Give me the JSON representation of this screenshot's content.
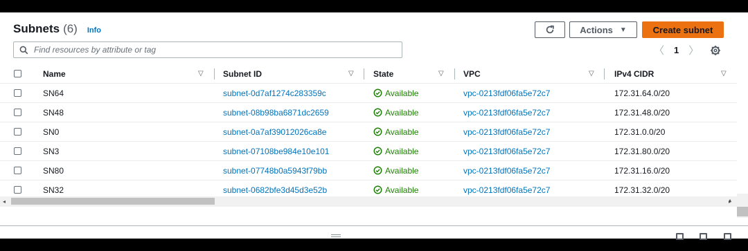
{
  "header": {
    "title": "Subnets",
    "count": "(6)",
    "info": "Info"
  },
  "toolbar": {
    "refresh_icon": "refresh-icon",
    "actions_label": "Actions",
    "create_label": "Create subnet",
    "accent_color": "#ec7211"
  },
  "search": {
    "placeholder": "Find resources by attribute or tag",
    "value": ""
  },
  "pagination": {
    "current_page": "1",
    "prev_icon": "chevron-left-icon",
    "next_icon": "chevron-right-icon",
    "settings_icon": "gear-icon"
  },
  "table": {
    "columns": [
      "Name",
      "Subnet ID",
      "State",
      "VPC",
      "IPv4 CIDR"
    ],
    "rows": [
      {
        "name": "SN64",
        "subnet_id": "subnet-0d7af1274c283359c",
        "state": "Available",
        "vpc": "vpc-0213fdf06fa5e72c7",
        "cidr": "172.31.64.0/20"
      },
      {
        "name": "SN48",
        "subnet_id": "subnet-08b98ba6871dc2659",
        "state": "Available",
        "vpc": "vpc-0213fdf06fa5e72c7",
        "cidr": "172.31.48.0/20"
      },
      {
        "name": "SN0",
        "subnet_id": "subnet-0a7af39012026ca8e",
        "state": "Available",
        "vpc": "vpc-0213fdf06fa5e72c7",
        "cidr": "172.31.0.0/20"
      },
      {
        "name": "SN3",
        "subnet_id": "subnet-07108be984e10e101",
        "state": "Available",
        "vpc": "vpc-0213fdf06fa5e72c7",
        "cidr": "172.31.80.0/20"
      },
      {
        "name": "SN80",
        "subnet_id": "subnet-07748b0a5943f79bb",
        "state": "Available",
        "vpc": "vpc-0213fdf06fa5e72c7",
        "cidr": "172.31.16.0/20"
      },
      {
        "name": "SN32",
        "subnet_id": "subnet-0682bfe3d45d3e52b",
        "state": "Available",
        "vpc": "vpc-0213fdf06fa5e72c7",
        "cidr": "172.31.32.0/20"
      }
    ]
  },
  "colors": {
    "link": "#0073bb",
    "available": "#1d8102"
  }
}
